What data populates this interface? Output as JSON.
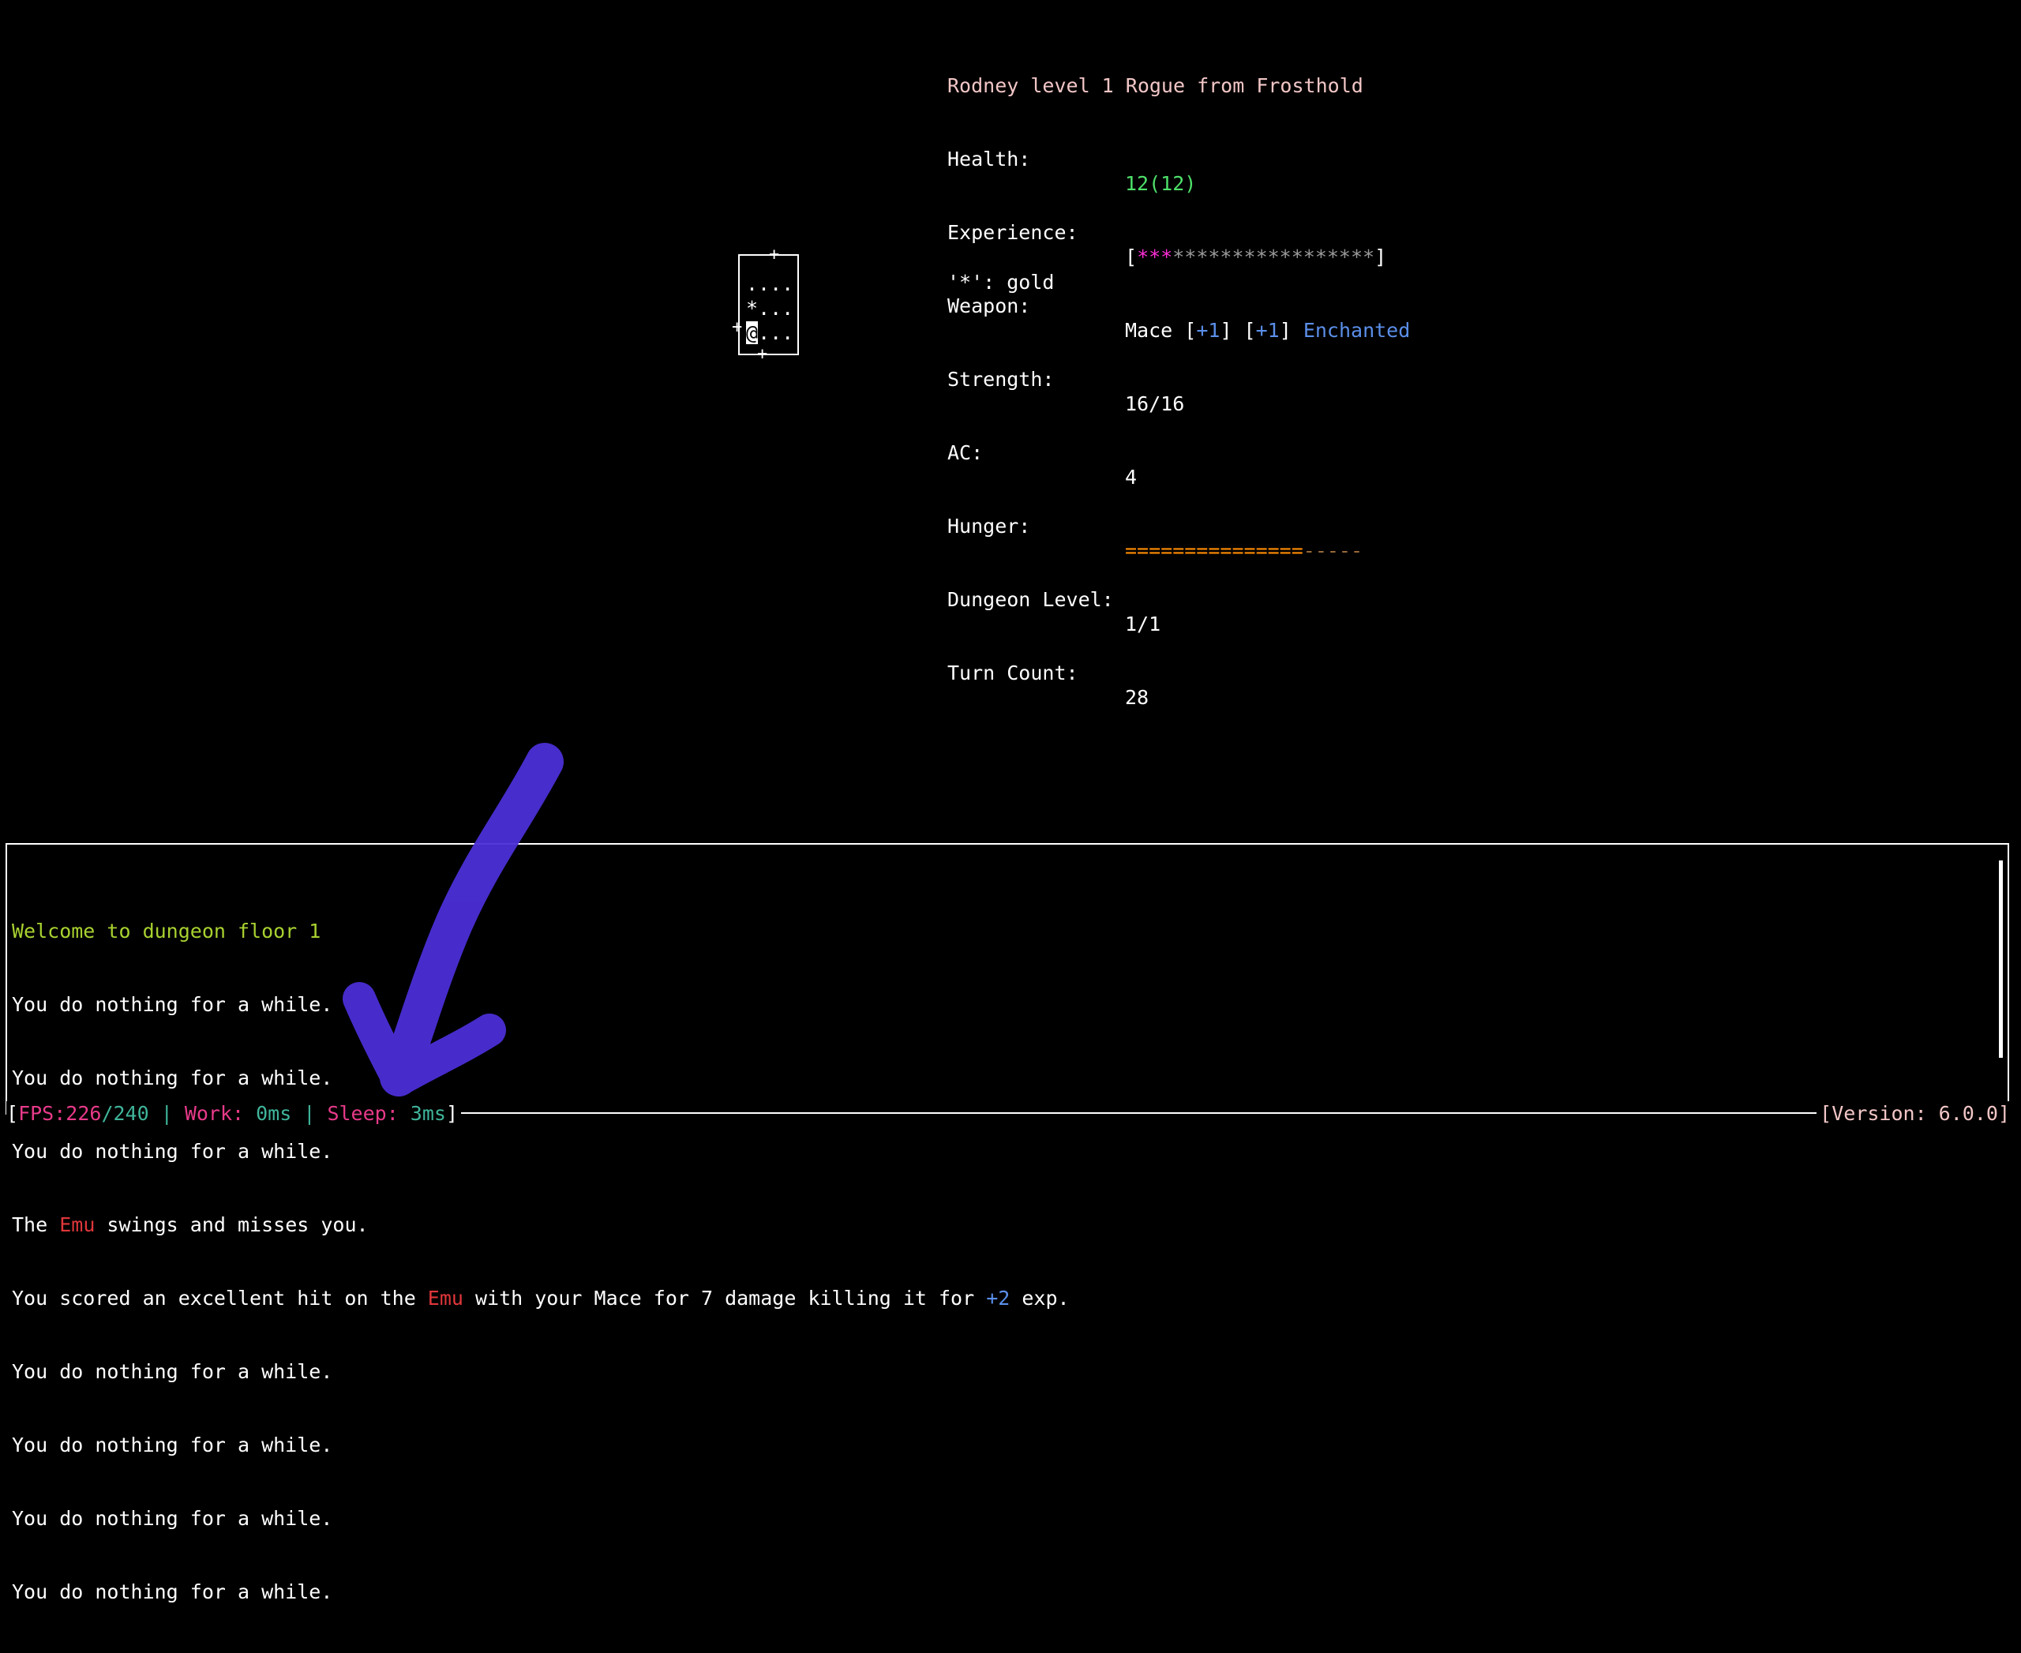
{
  "character": {
    "name": "Rodney",
    "title_text": "Rodney level 1 Rogue from Frosthold"
  },
  "stats": {
    "health_label": "Health:",
    "health_value": "12(12)",
    "experience_label": "Experience:",
    "experience_open": "[",
    "experience_filled": "***",
    "experience_empty": "*****************",
    "experience_close": "]",
    "weapon_label": "Weapon:",
    "weapon_name": "Mace ",
    "weapon_bonus1_open": "[",
    "weapon_bonus1": "+1",
    "weapon_bonus1_close": "] ",
    "weapon_bonus2_open": "[",
    "weapon_bonus2": "+1",
    "weapon_bonus2_close": "] ",
    "weapon_enchant": "Enchanted",
    "strength_label": "Strength:",
    "strength_value": "16/16",
    "ac_label": "AC:",
    "ac_value": "4",
    "hunger_label": "Hunger:",
    "hunger_filled": "===============",
    "hunger_empty": "-----",
    "dungeon_label": "Dungeon Level:",
    "dungeon_value": "1/1",
    "turn_label": "Turn Count:",
    "turn_value": "28"
  },
  "map": {
    "row1": "....",
    "row2_item": "*",
    "row2_rest": "...",
    "row3_player": "@",
    "row3_rest": "...",
    "door_top": "+",
    "door_left": "+",
    "door_bottom": "+"
  },
  "legend": {
    "text": "'*': gold"
  },
  "log": {
    "line1": "Welcome to dungeon floor 1",
    "line2": "You do nothing for a while.",
    "line3": "You do nothing for a while.",
    "line4": "You do nothing for a while.",
    "line5_a": "The ",
    "line5_monster": "Emu",
    "line5_b": " swings and misses you.",
    "line6_a": "You scored an excellent hit on the ",
    "line6_monster": "Emu",
    "line6_b": " with your Mace for 7 damage killing it for ",
    "line6_exp": "+2",
    "line6_c": " exp.",
    "line7": "You do nothing for a while.",
    "line8": "You do nothing for a while.",
    "line9": "You do nothing for a while.",
    "line10": "You do nothing for a while."
  },
  "statusbar": {
    "open": "[",
    "fps_label": "FPS:",
    "fps_value": "226",
    "fps_sep": "/",
    "fps_target": "240",
    "sep": " | ",
    "work_label": "Work: ",
    "work_value": "0ms",
    "sleep_label": "Sleep: ",
    "sleep_value": "3ms",
    "close": "]",
    "version_text": "[Version: 6.0.0]"
  },
  "colors": {
    "background": "#000000",
    "name": "#f2c6c6",
    "health": "#4ee06a",
    "experience_fill": "#ff2ed7",
    "bonus_blue": "#5b8fea",
    "hunger_fill": "#ff8c00",
    "monster_red": "#e0363a",
    "welcome_green": "#a8d130",
    "annotation_arrow": "#4b2fd6"
  },
  "annotation": {
    "icon": "purple-arrow-icon"
  }
}
